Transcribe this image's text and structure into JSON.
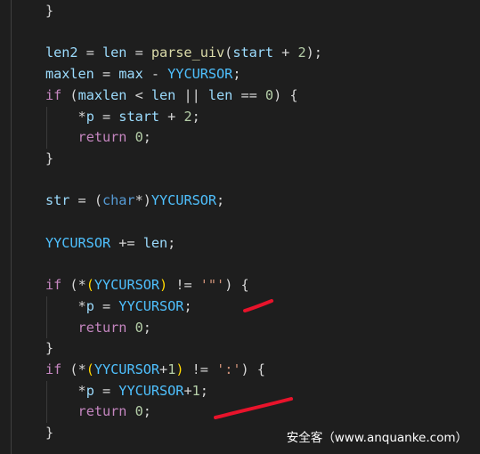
{
  "code_lines": [
    [
      {
        "t": "    ",
        "c": "pun"
      },
      {
        "t": "}",
        "c": "pun"
      }
    ],
    [],
    [
      {
        "t": "    ",
        "c": "pun"
      },
      {
        "t": "len2",
        "c": "var"
      },
      {
        "t": " = ",
        "c": "op"
      },
      {
        "t": "len",
        "c": "var"
      },
      {
        "t": " = ",
        "c": "op"
      },
      {
        "t": "parse_uiv",
        "c": "fn"
      },
      {
        "t": "(",
        "c": "pun"
      },
      {
        "t": "start",
        "c": "var"
      },
      {
        "t": " + ",
        "c": "op"
      },
      {
        "t": "2",
        "c": "num"
      },
      {
        "t": ");",
        "c": "pun"
      }
    ],
    [
      {
        "t": "    ",
        "c": "pun"
      },
      {
        "t": "maxlen",
        "c": "var"
      },
      {
        "t": " = ",
        "c": "op"
      },
      {
        "t": "max",
        "c": "var"
      },
      {
        "t": " - ",
        "c": "op"
      },
      {
        "t": "YYCURSOR",
        "c": "mac"
      },
      {
        "t": ";",
        "c": "pun"
      }
    ],
    [
      {
        "t": "    ",
        "c": "pun"
      },
      {
        "t": "if",
        "c": "kw"
      },
      {
        "t": " (",
        "c": "pun"
      },
      {
        "t": "maxlen",
        "c": "var"
      },
      {
        "t": " < ",
        "c": "op"
      },
      {
        "t": "len",
        "c": "var"
      },
      {
        "t": " || ",
        "c": "op"
      },
      {
        "t": "len",
        "c": "var"
      },
      {
        "t": " == ",
        "c": "op"
      },
      {
        "t": "0",
        "c": "num"
      },
      {
        "t": ") {",
        "c": "pun"
      }
    ],
    [
      {
        "t": "        ",
        "c": "pun"
      },
      {
        "t": "*",
        "c": "op"
      },
      {
        "t": "p",
        "c": "var"
      },
      {
        "t": " = ",
        "c": "op"
      },
      {
        "t": "start",
        "c": "var"
      },
      {
        "t": " + ",
        "c": "op"
      },
      {
        "t": "2",
        "c": "num"
      },
      {
        "t": ";",
        "c": "pun"
      }
    ],
    [
      {
        "t": "        ",
        "c": "pun"
      },
      {
        "t": "return",
        "c": "kw"
      },
      {
        "t": " ",
        "c": "pun"
      },
      {
        "t": "0",
        "c": "num"
      },
      {
        "t": ";",
        "c": "pun"
      }
    ],
    [
      {
        "t": "    ",
        "c": "pun"
      },
      {
        "t": "}",
        "c": "pun"
      }
    ],
    [],
    [
      {
        "t": "    ",
        "c": "pun"
      },
      {
        "t": "str",
        "c": "var"
      },
      {
        "t": " = ",
        "c": "op"
      },
      {
        "t": "(",
        "c": "pun"
      },
      {
        "t": "char",
        "c": "type"
      },
      {
        "t": "*)",
        "c": "pun"
      },
      {
        "t": "YYCURSOR",
        "c": "mac"
      },
      {
        "t": ";",
        "c": "pun"
      }
    ],
    [],
    [
      {
        "t": "    ",
        "c": "pun"
      },
      {
        "t": "YYCURSOR",
        "c": "mac"
      },
      {
        "t": " += ",
        "c": "op"
      },
      {
        "t": "len",
        "c": "var"
      },
      {
        "t": ";",
        "c": "pun"
      }
    ],
    [],
    [
      {
        "t": "    ",
        "c": "pun"
      },
      {
        "t": "if",
        "c": "kw"
      },
      {
        "t": " (",
        "c": "pun"
      },
      {
        "t": "*",
        "c": "op"
      },
      {
        "t": "(",
        "c": "brk"
      },
      {
        "t": "YYCURSOR",
        "c": "mac"
      },
      {
        "t": ")",
        "c": "brk"
      },
      {
        "t": " != ",
        "c": "op"
      },
      {
        "t": "'\"'",
        "c": "str"
      },
      {
        "t": ") {",
        "c": "pun"
      }
    ],
    [
      {
        "t": "        ",
        "c": "pun"
      },
      {
        "t": "*",
        "c": "op"
      },
      {
        "t": "p",
        "c": "var"
      },
      {
        "t": " = ",
        "c": "op"
      },
      {
        "t": "YYCURSOR",
        "c": "mac"
      },
      {
        "t": ";",
        "c": "pun"
      }
    ],
    [
      {
        "t": "        ",
        "c": "pun"
      },
      {
        "t": "return",
        "c": "kw"
      },
      {
        "t": " ",
        "c": "pun"
      },
      {
        "t": "0",
        "c": "num"
      },
      {
        "t": ";",
        "c": "pun"
      }
    ],
    [
      {
        "t": "    ",
        "c": "pun"
      },
      {
        "t": "}",
        "c": "pun"
      }
    ],
    [
      {
        "t": "    ",
        "c": "pun"
      },
      {
        "t": "if",
        "c": "kw"
      },
      {
        "t": " (",
        "c": "pun"
      },
      {
        "t": "*",
        "c": "op"
      },
      {
        "t": "(",
        "c": "brk"
      },
      {
        "t": "YYCURSOR",
        "c": "mac"
      },
      {
        "t": "+",
        "c": "op"
      },
      {
        "t": "1",
        "c": "num"
      },
      {
        "t": ")",
        "c": "brk"
      },
      {
        "t": " != ",
        "c": "op"
      },
      {
        "t": "':'",
        "c": "str"
      },
      {
        "t": ") {",
        "c": "pun"
      }
    ],
    [
      {
        "t": "        ",
        "c": "pun"
      },
      {
        "t": "*",
        "c": "op"
      },
      {
        "t": "p",
        "c": "var"
      },
      {
        "t": " = ",
        "c": "op"
      },
      {
        "t": "YYCURSOR",
        "c": "mac"
      },
      {
        "t": "+",
        "c": "op"
      },
      {
        "t": "1",
        "c": "num"
      },
      {
        "t": ";",
        "c": "pun"
      }
    ],
    [
      {
        "t": "        ",
        "c": "pun"
      },
      {
        "t": "return",
        "c": "kw"
      },
      {
        "t": " ",
        "c": "pun"
      },
      {
        "t": "0",
        "c": "num"
      },
      {
        "t": ";",
        "c": "pun"
      }
    ],
    [
      {
        "t": "    ",
        "c": "pun"
      },
      {
        "t": "}",
        "c": "pun"
      }
    ]
  ],
  "annotation_color": "#e8132b",
  "watermark": "安全客（www.anquanke.com）"
}
